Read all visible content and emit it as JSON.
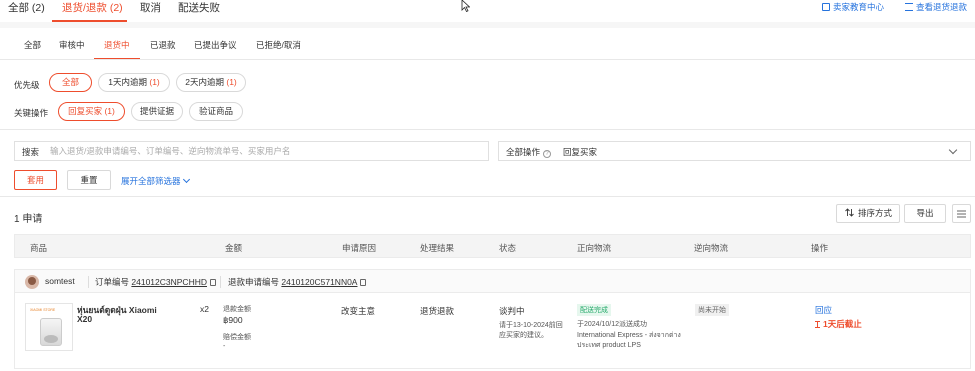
{
  "top_tabs": [
    {
      "label": "全部 (2)",
      "active": false
    },
    {
      "label": "退货/退款 (2)",
      "active": true
    },
    {
      "label": "取消",
      "active": false
    },
    {
      "label": "配送失败",
      "active": false
    }
  ],
  "top_links": {
    "seller_education": "卖家教育中心",
    "view_return_rules": "查看退货退款"
  },
  "sub_tabs": [
    {
      "label": "全部",
      "active": false
    },
    {
      "label": "审核中",
      "active": false
    },
    {
      "label": "退货中",
      "active": true
    },
    {
      "label": "已退款",
      "active": false
    },
    {
      "label": "已提出争议",
      "active": false
    },
    {
      "label": "已拒绝/取消",
      "active": false
    }
  ],
  "priority": {
    "label": "优先级",
    "options": [
      {
        "label": "全部",
        "count": "",
        "active": true
      },
      {
        "label": "1天内逾期",
        "count": "(1)",
        "active": false
      },
      {
        "label": "2天内逾期",
        "count": "(1)",
        "active": false
      }
    ]
  },
  "key_action": {
    "label": "关键操作",
    "options": [
      {
        "label": "回复买家 (1)",
        "active": true
      },
      {
        "label": "提供证据",
        "active": false
      },
      {
        "label": "验证商品",
        "active": false
      }
    ]
  },
  "search": {
    "label": "搜索",
    "placeholder": "输入退货/退款申请编号、订单编号、逆向物流单号、买家用户名"
  },
  "all_actions": {
    "label": "全部操作",
    "value": "回复买家"
  },
  "buttons": {
    "apply": "套用",
    "reset": "重置",
    "expand_filters": "展开全部筛选器"
  },
  "results": {
    "count_label": "1 申请",
    "sort_label": "排序方式",
    "export_label": "导出"
  },
  "table_headers": [
    "商品",
    "金额",
    "申请原因",
    "处理结果",
    "状态",
    "正向物流",
    "逆向物流",
    "操作"
  ],
  "order": {
    "buyer": "somtest",
    "order_no_label": "订单编号",
    "order_no": "241012C3NPCHHD",
    "return_no_label": "退款申请编号",
    "return_no": "2410120C571NN0A",
    "product_brand_text": "XIAOMI STORE",
    "product_name_line1": "หุ่นยนต์ดูดฝุ่น Xiaomi",
    "product_name_line2": "X20",
    "quantity": "x2",
    "refund_amount_label": "退款金额",
    "refund_amount": "฿900",
    "compensation_label": "赔偿金额",
    "compensation_amount": "-",
    "reason": "改变主意",
    "resolution": "退货退款",
    "status_title": "谈判中",
    "status_desc_line1": "请于13-10-2024前回",
    "status_desc_line2": "应买家的建议。",
    "forward_logistics_tag": "配送完成",
    "forward_logistics_line1": "于2024/10/12派送成功",
    "forward_logistics_line2": "International Express - ส่งจากต่าง",
    "forward_logistics_line3": "ประเทศ product LPS",
    "reverse_logistics_tag": "尚未开始",
    "action_reply": "回应",
    "deadline": "1天后截止"
  },
  "colors": {
    "accent": "#ee4d2d",
    "link": "#2673dd",
    "success": "#26aa6b"
  }
}
